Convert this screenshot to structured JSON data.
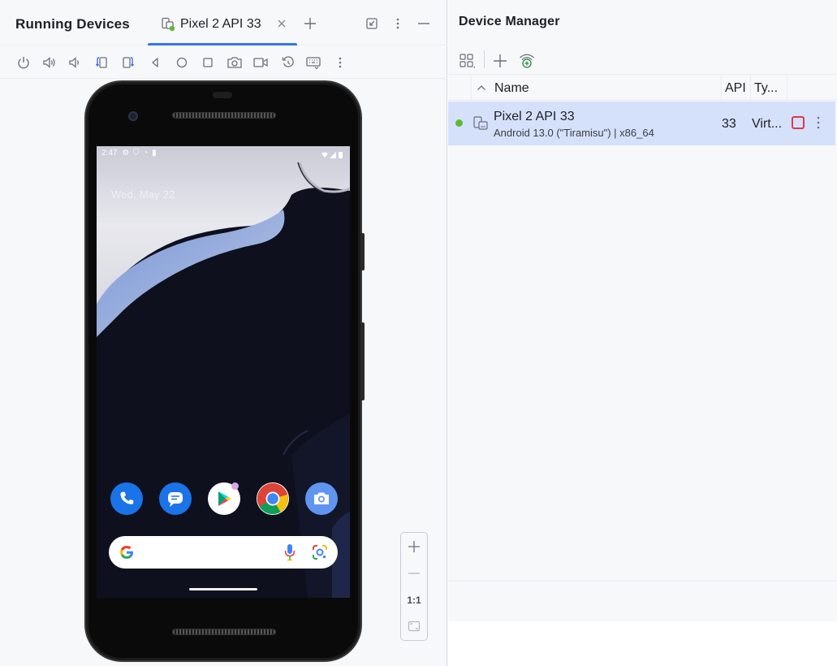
{
  "running_devices": {
    "title": "Running Devices",
    "tab": {
      "label": "Pixel 2 API 33"
    },
    "toolbar_icons": [
      "power-icon",
      "volume-up-icon",
      "volume-down-icon",
      "rotate-left-icon",
      "rotate-right-icon",
      "back-icon",
      "home-icon",
      "overview-icon",
      "screenshot-icon",
      "screen-record-icon",
      "reset-icon",
      "keyboard-icon",
      "more-icon"
    ],
    "phone_screen": {
      "status_time": "2:47",
      "date": "Wed, May 22",
      "apps": [
        "phone-app-icon",
        "messages-app-icon",
        "play-store-app-icon",
        "chrome-app-icon",
        "camera-app-icon"
      ]
    },
    "zoom": {
      "actual_size_label": "1:1"
    }
  },
  "device_manager": {
    "title": "Device Manager",
    "columns": {
      "name": "Name",
      "api": "API",
      "type": "Ty..."
    },
    "devices": [
      {
        "name": "Pixel 2 API 33",
        "details": "Android 13.0 (\"Tiramisu\") | x86_64",
        "api": "33",
        "type": "Virt...",
        "status": "online"
      }
    ]
  },
  "colors": {
    "accent": "#3574f0",
    "selected_row": "#d5e1fb",
    "online": "#5fb83b",
    "stop": "#db3b4b"
  }
}
